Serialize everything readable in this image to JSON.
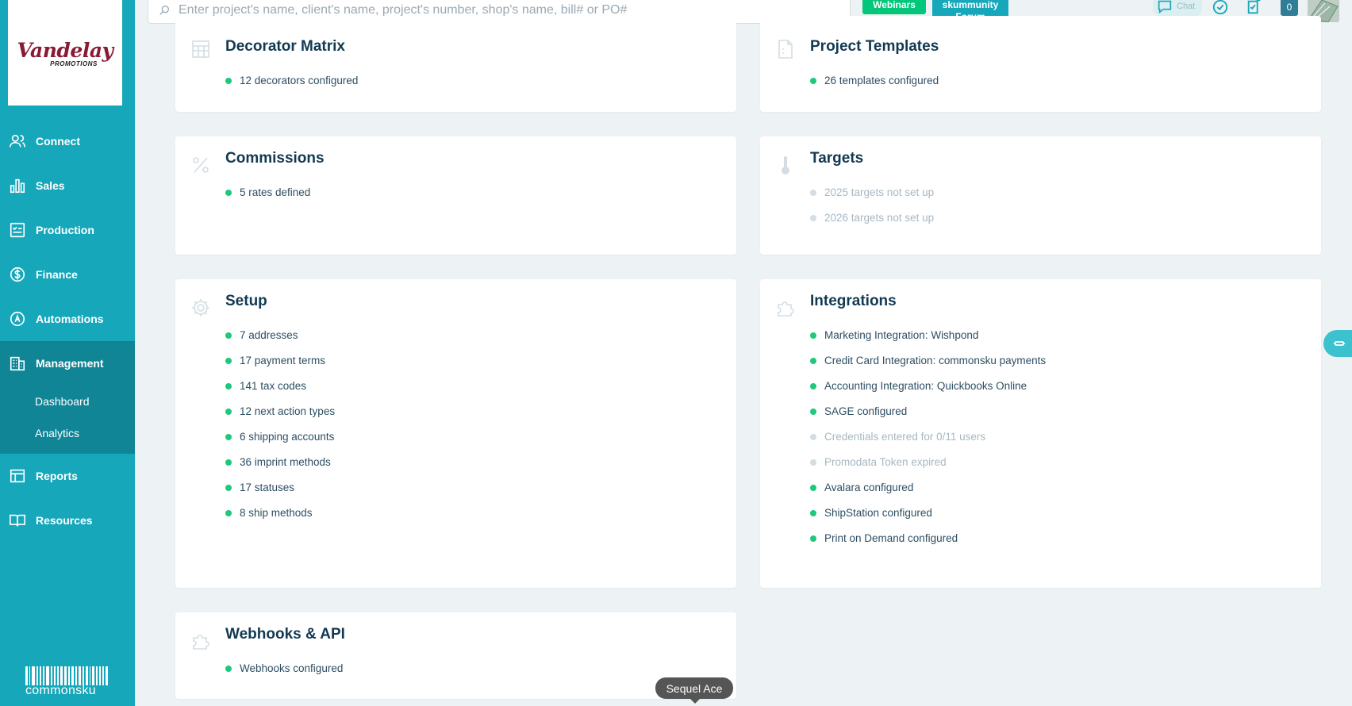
{
  "logo": {
    "main": "Vandelay",
    "sub": "PROMOTIONS"
  },
  "sidebar": {
    "items": [
      {
        "label": "Connect",
        "icon": "users-icon"
      },
      {
        "label": "Sales",
        "icon": "bar-chart-icon"
      },
      {
        "label": "Production",
        "icon": "checklist-icon"
      },
      {
        "label": "Finance",
        "icon": "dollar-icon"
      },
      {
        "label": "Automations",
        "icon": "automation-icon"
      },
      {
        "label": "Management",
        "icon": "building-icon"
      },
      {
        "label": "Reports",
        "icon": "table-icon"
      },
      {
        "label": "Resources",
        "icon": "book-icon"
      }
    ],
    "management_sub": [
      "Dashboard",
      "Analytics"
    ],
    "brand": "commonsku"
  },
  "header": {
    "search_placeholder": "Enter project's name, client's name, project's number, shop's name, bill# or PO#",
    "webinars": "Webinars",
    "forum_line1": "skummunity",
    "forum_line2": "Forum",
    "chat": "Chat",
    "notification_count": "0"
  },
  "cards": {
    "decorator_matrix": {
      "title": "Decorator Matrix",
      "items": [
        "12 decorators configured"
      ]
    },
    "project_templates": {
      "title": "Project Templates",
      "items": [
        "26 templates configured"
      ]
    },
    "commissions": {
      "title": "Commissions",
      "items": [
        "5 rates defined"
      ]
    },
    "targets": {
      "title": "Targets",
      "items": [
        "2025 targets not set up",
        "2026 targets not set up"
      ]
    },
    "setup": {
      "title": "Setup",
      "items": [
        "7 addresses",
        "17 payment terms",
        "141 tax codes",
        "12 next action types",
        "6 shipping accounts",
        "36 imprint methods",
        "17 statuses",
        "8 ship methods"
      ]
    },
    "integrations": {
      "title": "Integrations",
      "items": [
        "Marketing Integration: Wishpond",
        "Credit Card Integration: commonsku payments",
        "Accounting Integration: Quickbooks Online",
        "SAGE configured",
        "Credentials entered for 0/11 users",
        "Promodata Token expired",
        "Avalara configured",
        "ShipStation configured",
        "Print on Demand configured"
      ]
    },
    "webhooks": {
      "title": "Webhooks & API",
      "items": [
        "Webhooks configured"
      ]
    }
  },
  "tooltip": "Sequel Ace",
  "colors": {
    "sidebar": "#16a7ba",
    "sidebar_active": "#0f8596",
    "status_ok": "#1ec97a",
    "status_off": "#d3dde3",
    "webinars": "#02c77a"
  }
}
